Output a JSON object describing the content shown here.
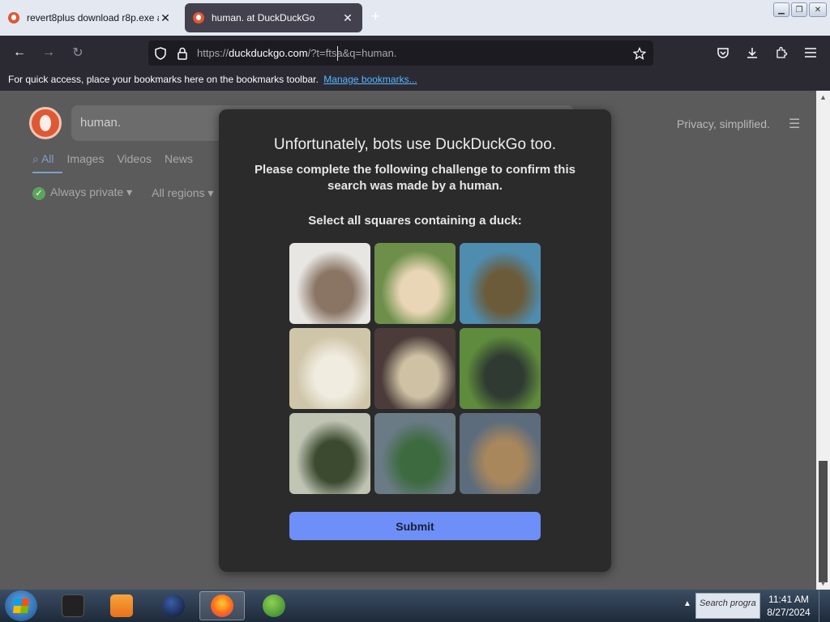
{
  "tabs": [
    {
      "title": "revert8plus download r8p.exe a",
      "close": "✕"
    },
    {
      "title": "human. at DuckDuckGo",
      "close": "✕"
    }
  ],
  "new_tab": "+",
  "nav": {
    "back": "←",
    "forward": "→",
    "reload": "↻"
  },
  "url": {
    "prefix": "https://",
    "domain": "duckduckgo.com",
    "path": "/?t=ftsa&q=human."
  },
  "bookmarks": {
    "text": "For quick access, place your bookmarks here on the bookmarks toolbar.",
    "link": "Manage bookmarks..."
  },
  "search": {
    "query": "human."
  },
  "header": {
    "tagline": "Privacy, simplified."
  },
  "verticals": [
    "All",
    "Images",
    "Videos",
    "News"
  ],
  "filters": {
    "safe": "Always private ▾",
    "region": "All regions ▾"
  },
  "modal": {
    "title": "Unfortunately, bots use DuckDuckGo too.",
    "subtitle": "Please complete the following challenge to confirm this search was made by a human.",
    "instruction": "Select all squares containing a duck:",
    "submit": "Submit"
  },
  "captcha_images": [
    {
      "name": "hyena-cub-image",
      "colors": [
        "#e8e6e2",
        "#8a7565"
      ]
    },
    {
      "name": "owl-image",
      "colors": [
        "#6d8f4a",
        "#e9d6b6"
      ]
    },
    {
      "name": "ducklings-on-water-image",
      "colors": [
        "#4f8db0",
        "#6b5b3a"
      ]
    },
    {
      "name": "polar-bear-image",
      "colors": [
        "#cfc5a8",
        "#f0ece0"
      ]
    },
    {
      "name": "wild-cat-image",
      "colors": [
        "#4b3c3a",
        "#cfc2a4"
      ]
    },
    {
      "name": "monkey-image",
      "colors": [
        "#5f8b3c",
        "#2f3a32"
      ]
    },
    {
      "name": "turtles-image",
      "colors": [
        "#bfc4b3",
        "#3c4a2f"
      ]
    },
    {
      "name": "mallard-ducks-image",
      "colors": [
        "#6b7b86",
        "#3d6b3f"
      ]
    },
    {
      "name": "duck-resting-image",
      "colors": [
        "#5d6c7c",
        "#a8875c"
      ]
    }
  ],
  "taskbar": {
    "search_placeholder": "Search progra",
    "time": "11:41 AM",
    "date": "8/27/2024"
  }
}
